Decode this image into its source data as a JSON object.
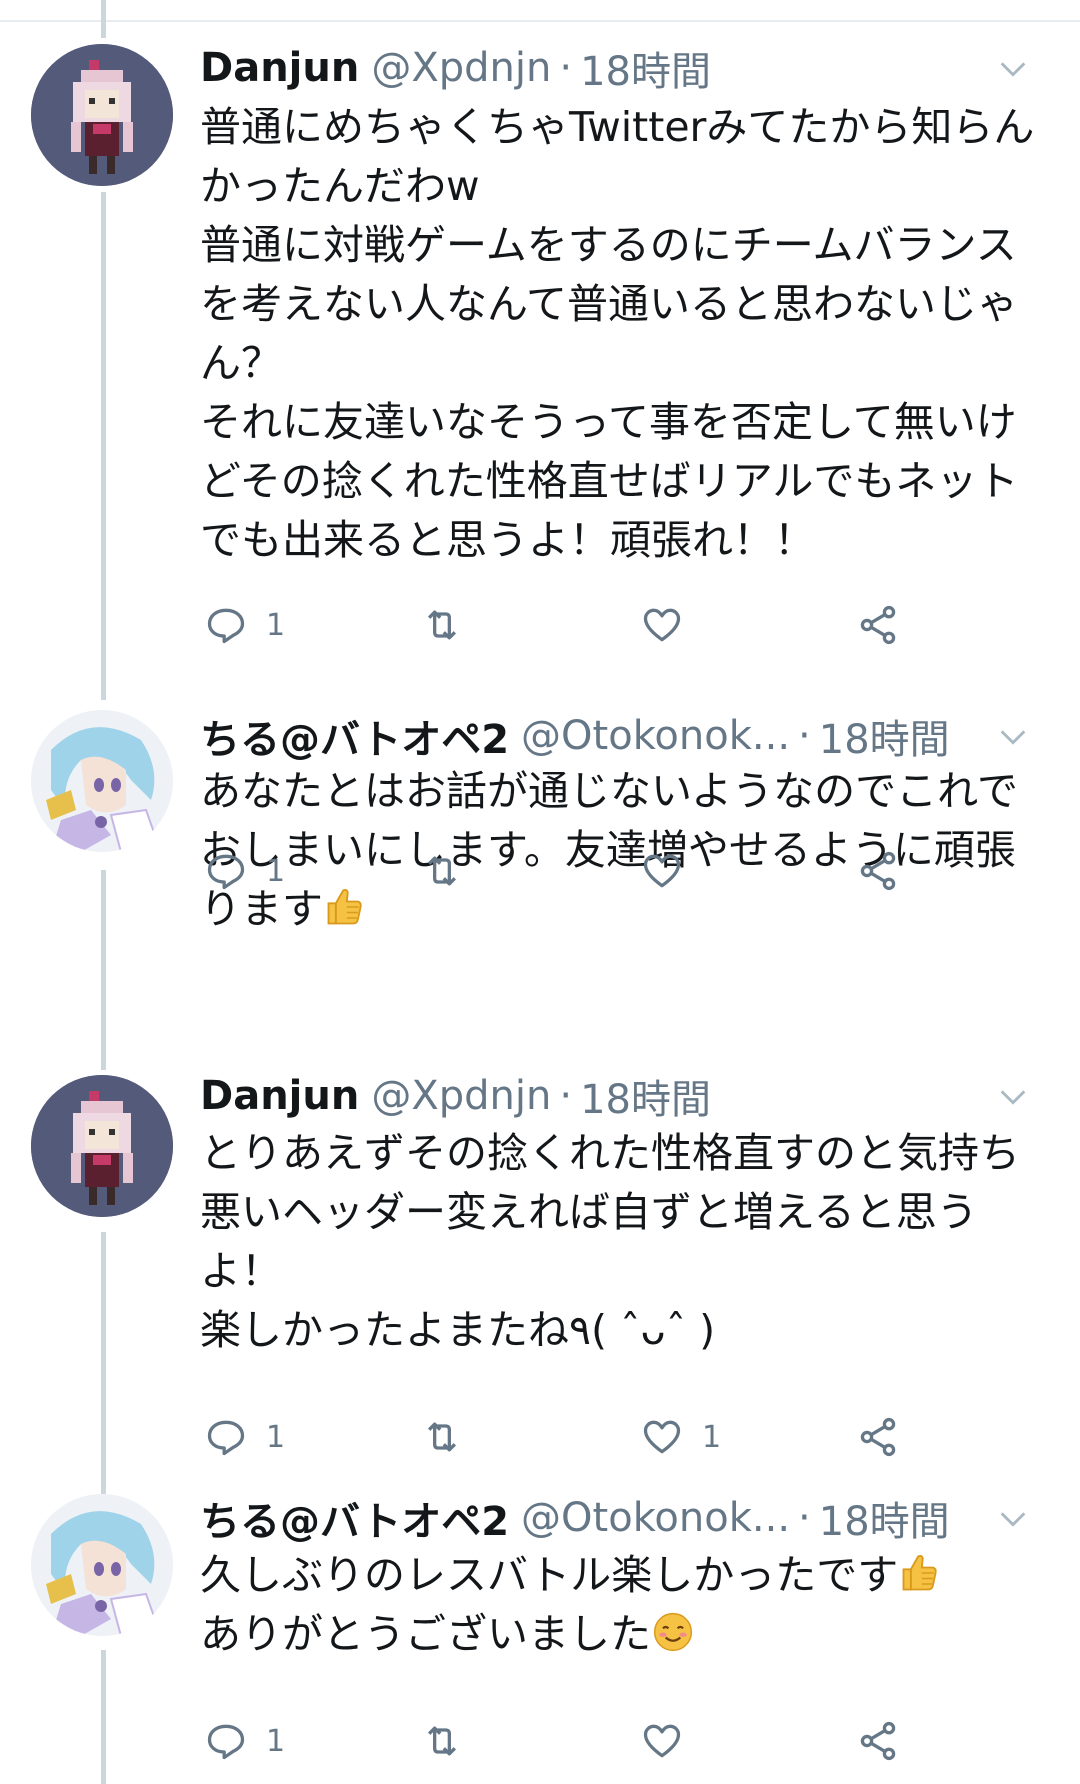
{
  "tweets": [
    {
      "name": "Danjun",
      "handle": "@Xpdnjn",
      "dot": "·",
      "time": "18時間",
      "text": "普通にめちゃくちゃTwitterみてたから知らんかったんだわw\n普通に対戦ゲームをするのにチームバランスを考えない人なんて普通いると思わないじゃん？\nそれに友達いなそうって事を否定して無いけどその捻くれた性格直せばリアルでもネットでも出来ると思うよ！頑張れ！！",
      "reply_count": "1",
      "retweet_count": "",
      "like_count": "",
      "avatar": "pixel-girl-avatar"
    },
    {
      "name": "ちる@バトオペ2",
      "handle": "@Otokonok...",
      "dot": "·",
      "time": "18時間",
      "text": "あなたとはお話が通じないようなのでこれでおしまいにします。友達増やせるように頑張ります",
      "emoji_after": "thumbs-up",
      "reply_count": "1",
      "retweet_count": "",
      "like_count": "",
      "avatar": "anime-girl-avatar"
    },
    {
      "name": "Danjun",
      "handle": "@Xpdnjn",
      "dot": "·",
      "time": "18時間",
      "text": "とりあえずその捻くれた性格直すのと気持ち悪いヘッダー変えれば自ずと増えると思うよ！\n楽しかったよまたね٩( ˆᴗˆ )",
      "reply_count": "1",
      "retweet_count": "",
      "like_count": "1",
      "avatar": "pixel-girl-avatar"
    },
    {
      "name": "ちる@バトオペ2",
      "handle": "@Otokonok...",
      "dot": "·",
      "time": "18時間",
      "text_line1": "久しぶりのレスバトル楽しかったです",
      "text_line2": "ありがとうございました",
      "reply_count": "1",
      "retweet_count": "",
      "like_count": "",
      "avatar": "anime-girl-avatar"
    }
  ],
  "colors": {
    "text": "#14171a",
    "muted": "#657786",
    "thread_line": "#ccd6dd",
    "avatar_bg_pixel": "#545a7a"
  }
}
